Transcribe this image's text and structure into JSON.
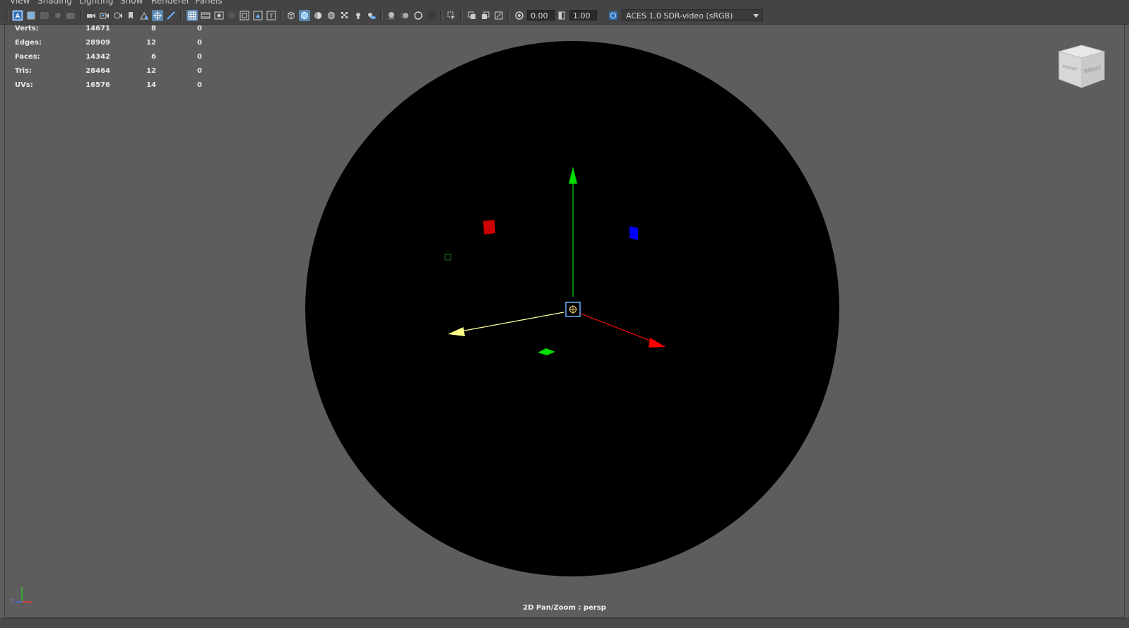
{
  "menu": {
    "items": [
      "View",
      "Shading",
      "Lighting",
      "Show",
      "Renderer",
      "Panels"
    ]
  },
  "toolbar": {
    "exposure_value": "0.00",
    "gamma_value": "1.00",
    "color_space": "ACES 1.0 SDR-video (sRGB)",
    "icons": [
      "select-camera-icon",
      "camera-attributes-icon",
      "bookmarks-icon",
      "image-plane-icon",
      "2d-pan-zoom-icon",
      "grease-pencil-icon",
      "grid-icon",
      "film-gate-icon",
      "resolution-gate-icon",
      "gate-mask-icon",
      "field-chart-icon",
      "safe-action-icon",
      "safe-title-icon",
      "wireframe-icon",
      "smooth-shade-icon",
      "default-material-icon",
      "wireframe-on-shaded-icon",
      "textured-icon",
      "lighting-icon",
      "shadows-icon",
      "screen-space-ao-icon",
      "motion-blur-icon",
      "anti-aliasing-icon",
      "depth-of-field-icon",
      "isolate-select-icon",
      "xray-icon",
      "xray-joints-icon",
      "xray-components-icon",
      "exposure-icon",
      "gamma-icon",
      "color-management-icon"
    ]
  },
  "hud": {
    "rows": [
      {
        "label": "Verts:",
        "total": "14671",
        "selected": "8",
        "tri": "0"
      },
      {
        "label": "Edges:",
        "total": "28909",
        "selected": "12",
        "tri": "0"
      },
      {
        "label": "Faces:",
        "total": "14342",
        "selected": "6",
        "tri": "0"
      },
      {
        "label": "Tris:",
        "total": "28464",
        "selected": "12",
        "tri": "0"
      },
      {
        "label": "UVs:",
        "total": "16576",
        "selected": "14",
        "tri": "0"
      }
    ]
  },
  "viewcube": {
    "face_front": "FRONT",
    "face_right": "RIGHT"
  },
  "axis_indicator": {
    "x": "x",
    "y": "y",
    "z": "z"
  },
  "status": {
    "mode_label": "2D Pan/Zoom : persp"
  },
  "colors": {
    "viewport_bg": "#5d5d5d",
    "toolbar_bg": "#444444",
    "object_fill": "#000000",
    "axis_x": "#ff0000",
    "axis_y": "#00dd00",
    "axis_z": "#ffff88",
    "handle_blue": "#0000ff",
    "manip_center": "#6ab0ff"
  }
}
